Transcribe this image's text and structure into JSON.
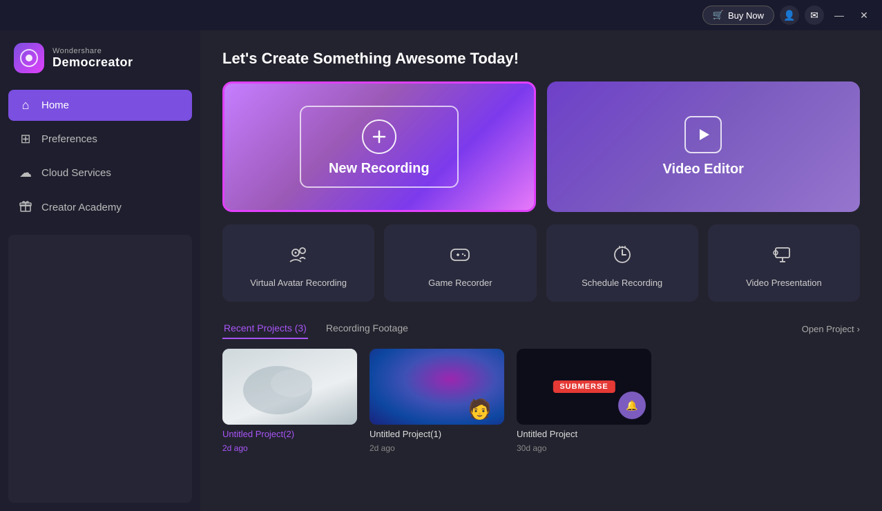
{
  "titlebar": {
    "buy_now": "Buy Now",
    "buy_icon": "🛒",
    "minimize": "—",
    "close": "✕"
  },
  "sidebar": {
    "logo_top": "Wondershare",
    "logo_bottom": "Democreator",
    "logo_char": "●",
    "nav_items": [
      {
        "id": "home",
        "label": "Home",
        "icon": "⌂",
        "active": true
      },
      {
        "id": "preferences",
        "label": "Preferences",
        "icon": "⊞",
        "active": false
      },
      {
        "id": "cloud-services",
        "label": "Cloud Services",
        "icon": "☁",
        "active": false
      },
      {
        "id": "creator-academy",
        "label": "Creator Academy",
        "icon": "✦",
        "active": false
      }
    ]
  },
  "main": {
    "page_title": "Let's Create Something Awesome Today!",
    "cards": {
      "new_recording_label": "New Recording",
      "video_editor_label": "Video Editor"
    },
    "tools": [
      {
        "id": "virtual-avatar",
        "label": "Virtual Avatar Recording"
      },
      {
        "id": "game-recorder",
        "label": "Game Recorder"
      },
      {
        "id": "schedule-recording",
        "label": "Schedule Recording"
      },
      {
        "id": "video-presentation",
        "label": "Video Presentation"
      }
    ],
    "tabs": [
      {
        "id": "recent-projects",
        "label": "Recent Projects (3)",
        "active": true
      },
      {
        "id": "recording-footage",
        "label": "Recording Footage",
        "active": false
      }
    ],
    "open_project_label": "Open Project",
    "projects": [
      {
        "id": "project-2",
        "name": "Untitled Project(2)",
        "date": "2d ago",
        "name_active": true
      },
      {
        "id": "project-1",
        "name": "Untitled Project(1)",
        "date": "2d ago",
        "name_active": false
      },
      {
        "id": "project-0",
        "name": "Untitled Project",
        "date": "30d ago",
        "name_active": false
      }
    ]
  }
}
